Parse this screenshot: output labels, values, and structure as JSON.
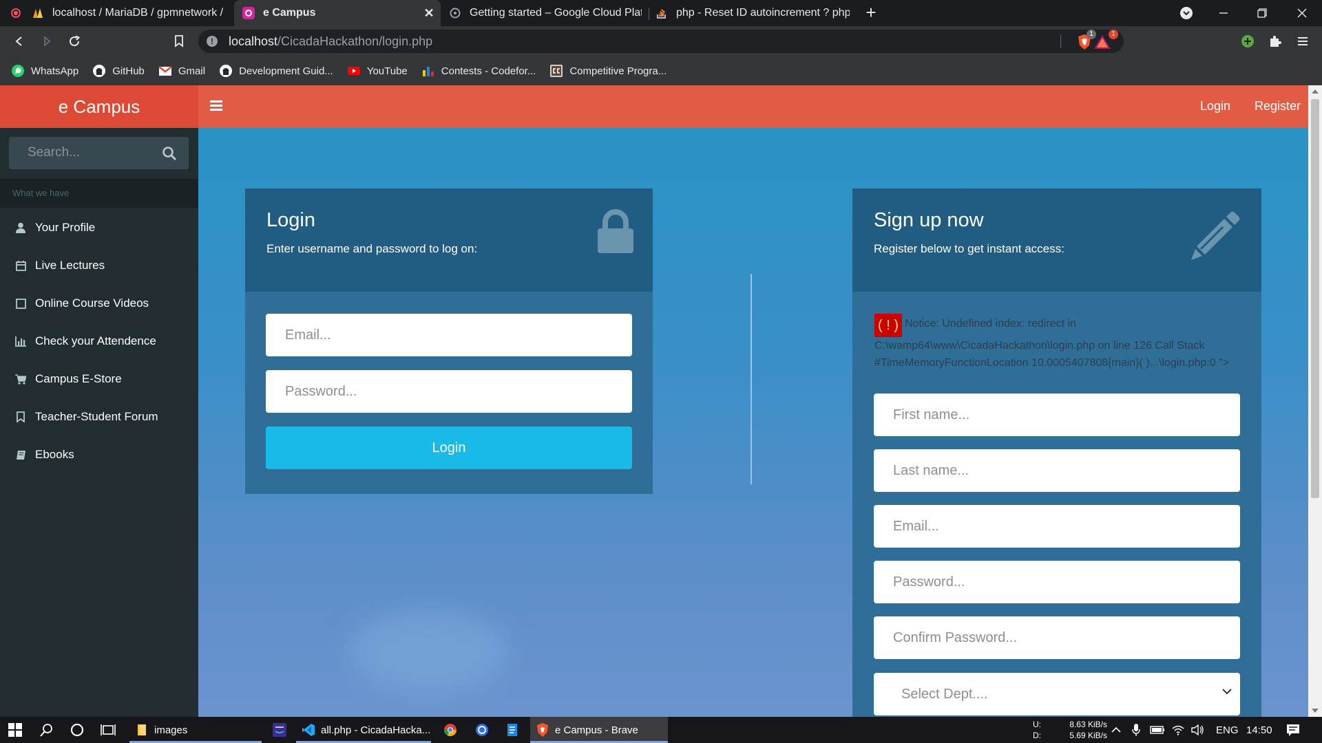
{
  "browser": {
    "tabs": [
      {
        "title": "localhost / MariaDB / gpmnetwork / le"
      },
      {
        "title": "e Campus",
        "close": "✕"
      },
      {
        "title": "Getting started – Google Cloud Platfor"
      },
      {
        "title": "php - Reset ID autoincrement ? phpm"
      }
    ],
    "new_tab": "+",
    "url_host": "localhost",
    "url_path": "/CicadaHackathon/login.php",
    "info_glyph": "!",
    "shield_count": "1",
    "rewards_count": "1",
    "bookmarks": [
      {
        "label": "WhatsApp",
        "icon": "whatsapp-icon"
      },
      {
        "label": "GitHub",
        "icon": "github-icon"
      },
      {
        "label": "Gmail",
        "icon": "gmail-icon"
      },
      {
        "label": "Development Guid...",
        "icon": "github-icon"
      },
      {
        "label": "YouTube",
        "icon": "youtube-icon"
      },
      {
        "label": "Contests - Codefor...",
        "icon": "codeforces-icon"
      },
      {
        "label": "Competitive Progra...",
        "icon": "codechef-icon"
      }
    ]
  },
  "app": {
    "brand": "e Campus",
    "top_links": {
      "login": "Login",
      "register": "Register"
    },
    "colors": {
      "topbar": "#e25c44",
      "brand_bg": "#dc4a35",
      "sidebar": "#222d32",
      "accent_button": "#19b9e8"
    }
  },
  "sidebar": {
    "search_placeholder": "Search...",
    "section_header": "What we have",
    "items": [
      {
        "label": "Your Profile",
        "icon": "user-icon"
      },
      {
        "label": "Live Lectures",
        "icon": "calendar-icon"
      },
      {
        "label": "Online Course Videos",
        "icon": "video-icon"
      },
      {
        "label": "Check your Attendence",
        "icon": "bar-chart-icon"
      },
      {
        "label": "Campus E-Store",
        "icon": "cart-icon"
      },
      {
        "label": "Teacher-Student Forum",
        "icon": "bookmark-icon"
      },
      {
        "label": "Ebooks",
        "icon": "book-icon"
      }
    ]
  },
  "login": {
    "title": "Login",
    "subtitle": "Enter username and password to log on:",
    "email_placeholder": "Email...",
    "password_placeholder": "Password...",
    "button": "Login"
  },
  "signup": {
    "title": "Sign up now",
    "subtitle": "Register below to get instant access:",
    "notice_bang": "( ! )",
    "notice_text": "Notice: Undefined index: redirect in C:\\wamp64\\www\\CicadaHackathon\\login.php on line 126 Call Stack #TimeMemoryFunctionLocation 10.0005407808{main}( )...\\login.php:0 \">",
    "first_name_placeholder": "First name...",
    "last_name_placeholder": "Last name...",
    "email_placeholder": "Email...",
    "password_placeholder": "Password...",
    "confirm_password_placeholder": "Confirm Password...",
    "dept_select": "Select Dept...."
  },
  "taskbar": {
    "apps": [
      {
        "label": "images",
        "icon": "folder-icon"
      },
      {
        "label": "all.php - CicadaHacka...",
        "icon": "vscode-icon"
      },
      {
        "label": "e Campus - Brave",
        "icon": "brave-icon"
      }
    ],
    "net_up_label": "U:",
    "net_up": "8.63 KiB/s",
    "net_down_label": "D:",
    "net_down": "5.69 KiB/s",
    "language": "ENG",
    "time": "14:50"
  }
}
